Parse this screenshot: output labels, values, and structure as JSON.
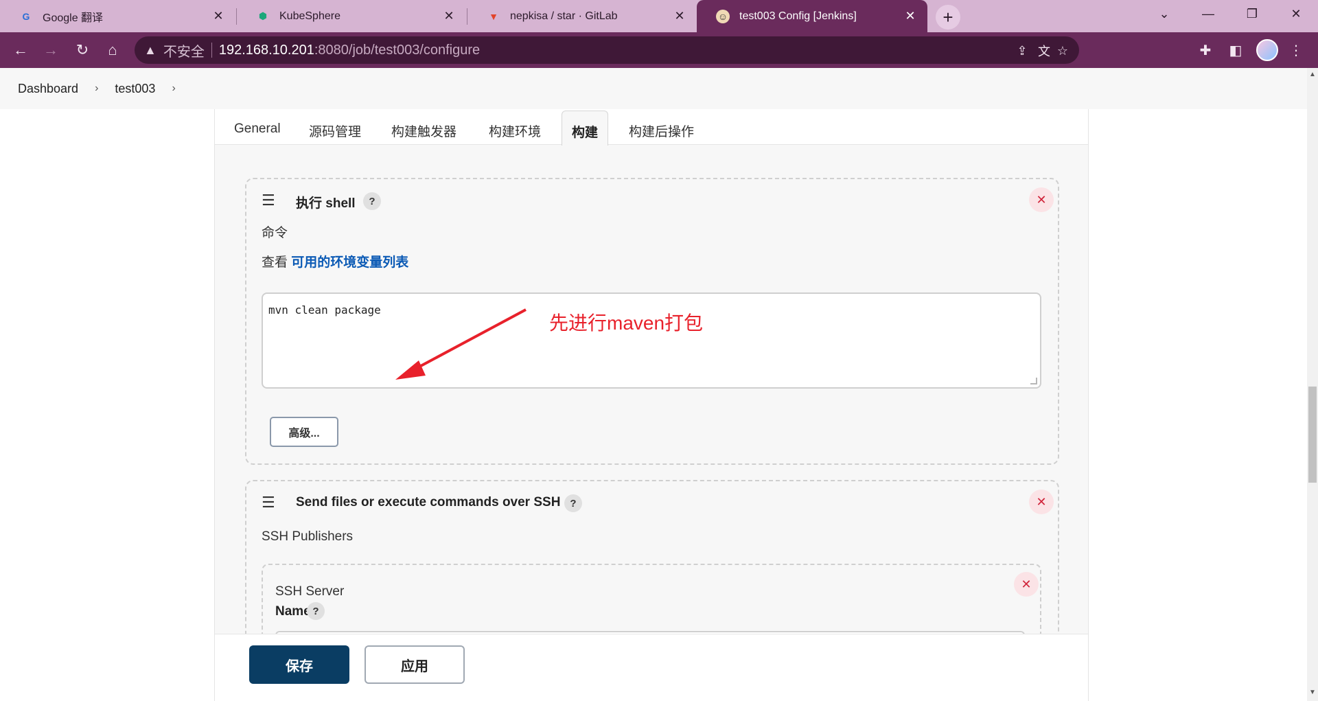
{
  "browser": {
    "tabs": [
      {
        "title": "Google 翻译",
        "icon": "google-translate-icon"
      },
      {
        "title": "KubeSphere",
        "icon": "kubesphere-icon"
      },
      {
        "title": "nepkisa / star · GitLab",
        "icon": "gitlab-icon"
      },
      {
        "title": "test003 Config [Jenkins]",
        "icon": "jenkins-icon",
        "active": true
      }
    ],
    "address": {
      "insecure_label": "不安全",
      "host": "192.168.10.201",
      "path": ":8080/job/test003/configure"
    },
    "accent_color": "#6a2b5c"
  },
  "breadcrumb": {
    "items": [
      "Dashboard",
      "test003"
    ]
  },
  "config_tabs": [
    "General",
    "源码管理",
    "构建触发器",
    "构建环境",
    "构建",
    "构建后操作"
  ],
  "active_tab": "构建",
  "shell_step": {
    "title": "执行 shell",
    "command_label": "命令",
    "env_prefix": "查看",
    "env_link": "可用的环境变量列表",
    "command_value": "mvn clean package",
    "advanced_button": "高级..."
  },
  "ssh_step": {
    "title": "Send files or execute commands over SSH",
    "publishers_label": "SSH Publishers",
    "server_label": "SSH Server",
    "name_label": "Name"
  },
  "annotation": {
    "text": "先进行maven打包",
    "color": "#e8212b"
  },
  "actions": {
    "save": "保存",
    "apply": "应用"
  }
}
